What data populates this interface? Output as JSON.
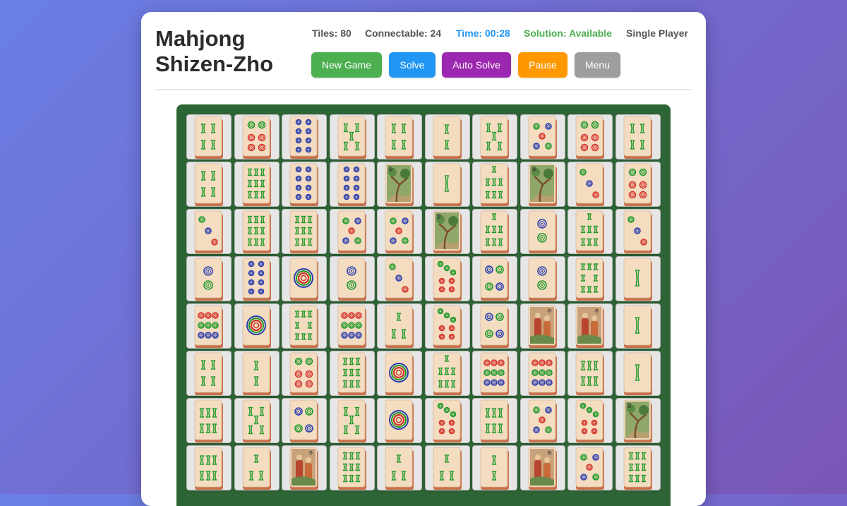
{
  "game": {
    "title_line1": "Mahjong",
    "title_line2": "Shizen-Zho"
  },
  "stats": {
    "tiles": "Tiles: 80",
    "connectable": "Connectable: 24",
    "time": "Time: 00:28",
    "solution": "Solution: Available",
    "mode": "Single Player"
  },
  "colors": {
    "time": "#2196f3",
    "solution": "#4caf50",
    "board": "#2e6536",
    "stat_text": "#555555"
  },
  "buttons": [
    {
      "label": "New Game",
      "color": "#4caf50"
    },
    {
      "label": "Solve",
      "color": "#2196f3"
    },
    {
      "label": "Auto Solve",
      "color": "#9c27b0"
    },
    {
      "label": "Pause",
      "color": "#ff9800"
    },
    {
      "label": "Menu",
      "color": "#9e9e9e"
    }
  ],
  "board": {
    "columns": 10,
    "visible_rows": 8,
    "rows": [
      [
        "bamboo-4",
        "circle-6",
        "circle-8",
        "bamboo-5",
        "bamboo-4",
        "bamboo-2",
        "bamboo-5",
        "circle-5",
        "circle-6",
        "bamboo-4"
      ],
      [
        "bamboo-4",
        "bamboo-9",
        "circle-8",
        "circle-8",
        "season-tree",
        "bamboo-1",
        "bamboo-7",
        "season-tree",
        "circle-3",
        "circle-6"
      ],
      [
        "circle-3",
        "bamboo-9",
        "bamboo-9",
        "circle-5",
        "circle-5",
        "season-tree",
        "bamboo-7",
        "circle-2",
        "bamboo-7",
        "circle-3"
      ],
      [
        "circle-2",
        "circle-8",
        "circle-1",
        "circle-2",
        "circle-3",
        "circle-7",
        "circle-4",
        "circle-2",
        "bamboo-8",
        "bamboo-1"
      ],
      [
        "circle-9",
        "circle-1",
        "bamboo-8",
        "circle-9",
        "bamboo-3",
        "circle-7",
        "circle-4",
        "season-people",
        "season-people",
        "bamboo-1"
      ],
      [
        "bamboo-4",
        "bamboo-2",
        "circle-6",
        "bamboo-9",
        "circle-1",
        "bamboo-7",
        "circle-9",
        "circle-9",
        "bamboo-6",
        "bamboo-1"
      ],
      [
        "bamboo-6",
        "bamboo-5",
        "circle-4",
        "bamboo-5",
        "circle-1",
        "circle-7",
        "bamboo-6",
        "circle-5",
        "circle-7",
        "season-tree"
      ],
      [
        "bamboo-6",
        "bamboo-3",
        "season-people",
        "bamboo-9",
        "bamboo-3",
        "bamboo-3",
        "bamboo-2",
        "season-people",
        "circle-5",
        "bamboo-9"
      ]
    ]
  }
}
